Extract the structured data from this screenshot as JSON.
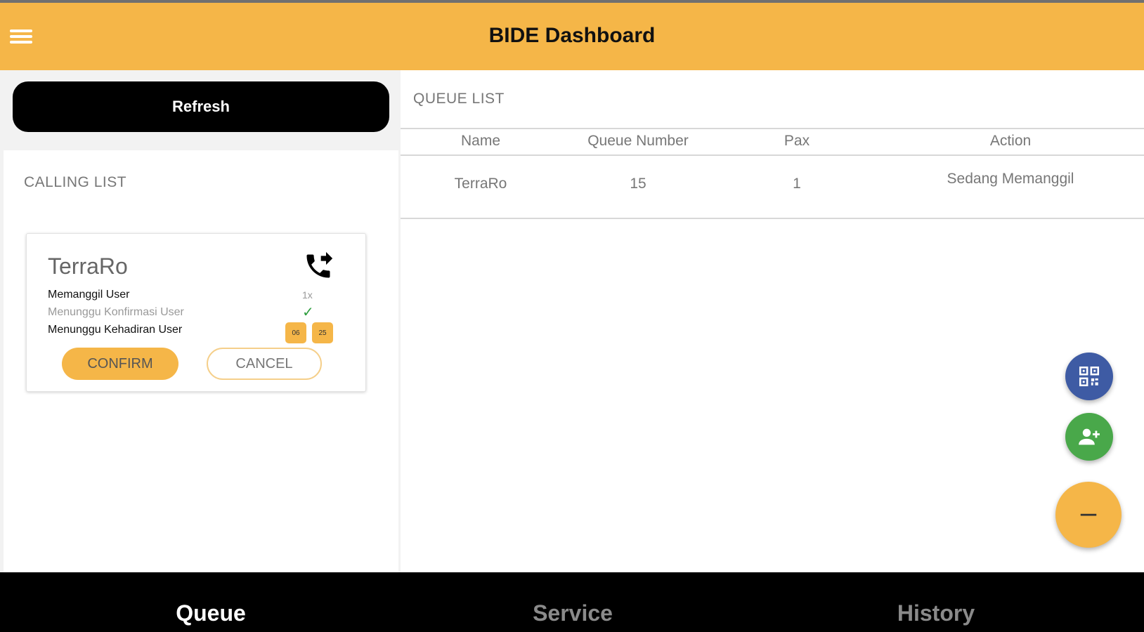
{
  "header": {
    "title": "BIDE Dashboard",
    "menu_icon": "hamburger-menu-icon"
  },
  "left": {
    "refresh_label": "Refresh",
    "calling_list_label": "CALLING LIST",
    "card": {
      "name": "TerraRo",
      "call_icon": "phone-forwarded-icon",
      "status_calling": "Memanggil User",
      "call_count": "1x",
      "status_waiting_confirm": "Menunggu Konfirmasi User",
      "status_waiting_arrival": "Menunggu Kehadiran User",
      "timer_minutes": "06",
      "timer_seconds": "25",
      "confirm_label": "CONFIRM",
      "cancel_label": "CANCEL"
    }
  },
  "queue": {
    "label": "QUEUE LIST",
    "columns": [
      "Name",
      "Queue Number",
      "Pax",
      "Action"
    ],
    "rows": [
      {
        "name": "TerraRo",
        "queue_number": "15",
        "pax": "1",
        "action": "Sedang Memanggil"
      }
    ]
  },
  "fabs": {
    "qr_icon": "qr-code-icon",
    "add_user_icon": "add-user-icon",
    "minus_icon": "minus-icon"
  },
  "bottom_nav": {
    "items": [
      "Queue",
      "Service",
      "History"
    ],
    "active": "Queue"
  },
  "colors": {
    "accent": "#f5b648",
    "fab_blue": "#3e5ba4",
    "fab_green": "#49a84a",
    "nav_bg": "#000000"
  }
}
